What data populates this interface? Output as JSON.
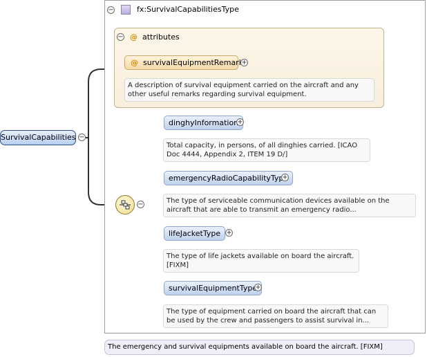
{
  "root": {
    "label": "SurvivalCapabilities"
  },
  "type": {
    "label": "fx:SurvivalCapabilitiesType"
  },
  "attributes": {
    "title": "attributes",
    "symbol": "@",
    "items": [
      {
        "label": "survivalEquipmentRemarks",
        "description": "A description of survival equipment carried on the aircraft and any other useful remarks regarding survival equipment."
      }
    ]
  },
  "elements": [
    {
      "label": "dinghyInformation",
      "description": "Total capacity, in persons, of all dinghies carried. [ICAO Doc 4444, Appendix 2, ITEM 19 D/]"
    },
    {
      "label": "emergencyRadioCapabilityType",
      "description": "The type of serviceable communication devices available on the aircraft that are able to transmit an emergency radio..."
    },
    {
      "label": "lifeJacketType",
      "description": "The type of life jackets available on board the aircraft. [FIXM]"
    },
    {
      "label": "survivalEquipmentType",
      "description": "The type of equipment carried on board the aircraft that can be used by the crew and passengers to assist survival in..."
    }
  ],
  "root_description": "The emergency and survival equipments available on board the aircraft. [FIXM]",
  "toggles": {
    "expanded": "−",
    "collapsed": "+"
  }
}
